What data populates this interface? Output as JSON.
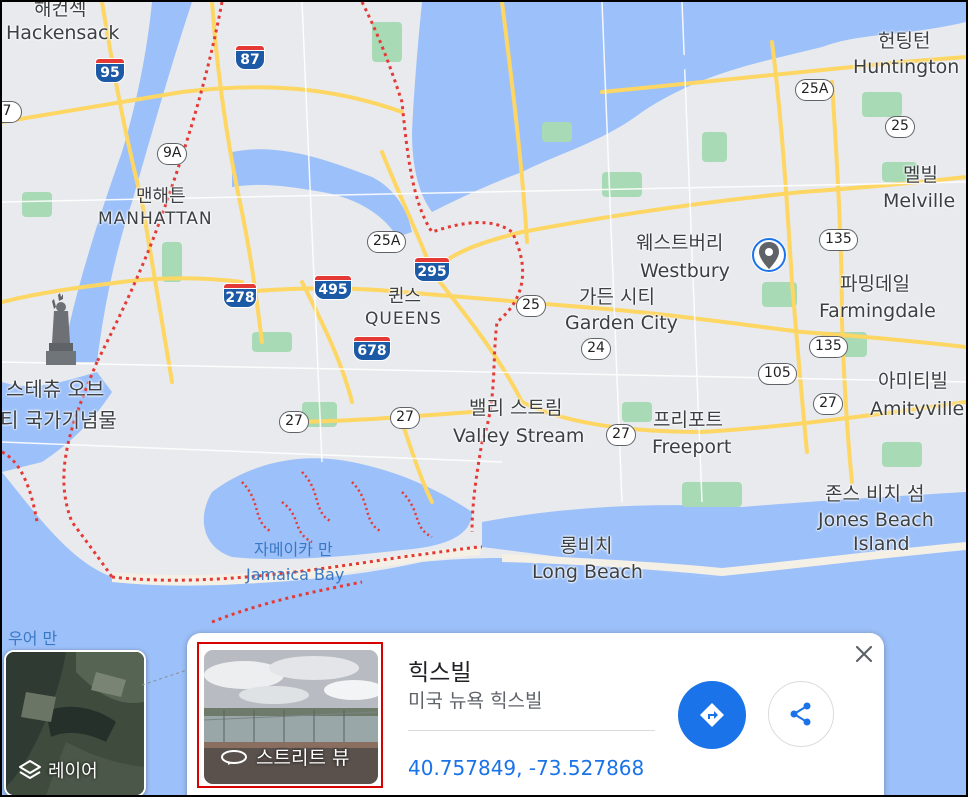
{
  "map": {
    "colors": {
      "water": "#9cc0f9",
      "land": "#e8eaed",
      "park": "#a8dab5",
      "highway": "#fdd663",
      "boundary": "#e53935"
    },
    "labels": {
      "hackensack_ko": "해컨섹",
      "hackensack": "Hackensack",
      "huntington_ko": "헌팅턴",
      "huntington": "Huntington",
      "melville_ko": "멜빌",
      "melville": "Melville",
      "manhattan_ko": "맨해튼",
      "manhattan": "MANHATTAN",
      "queens_ko": "퀸스",
      "queens": "QUEENS",
      "westbury_ko": "웨스트버리",
      "westbury": "Westbury",
      "gardencity_ko": "가든 시티",
      "gardencity": "Garden City",
      "farmingdale_ko": "파밍데일",
      "farmingdale": "Farmingdale",
      "liberty_ko_1": "스테츄 오브",
      "liberty_ko_2": "티 국가기념물",
      "valleystream_ko": "밸리 스트림",
      "valleystream": "Valley Stream",
      "freeport_ko": "프리포트",
      "freeport": "Freeport",
      "amityville_ko": "아미티빌",
      "amityville": "Amityville",
      "jonesbeach_ko": "존스 비치 섬",
      "jonesbeach_1": "Jones Beach",
      "jonesbeach_2": "Island",
      "longbeach_ko": "롱비치",
      "longbeach": "Long Beach",
      "jamaicabay_ko": "자메이카 만",
      "jamaicabay": "Jamaica Bay",
      "bay_partial": "우어 만"
    },
    "shields": {
      "i95": "95",
      "i87": "87",
      "i278": "278",
      "i495": "495",
      "i295": "295",
      "i678": "678",
      "r9a": "9A",
      "r25a": "25A",
      "r25a_e": "25A",
      "r25_e": "25",
      "r25": "25",
      "r24": "24",
      "r135_n": "135",
      "r135_s": "135",
      "r105": "105",
      "r27_e": "27",
      "r27_m": "27",
      "r27_w": "27",
      "r27_f": "27",
      "r7": "7"
    }
  },
  "layer": {
    "label": "레이어",
    "icon": "layers-icon"
  },
  "card": {
    "title": "힉스빌",
    "subtitle": "미국 뉴욕 힉스빌",
    "coordinates": "40.757849, -73.527868",
    "streetview_label": "스트리트 뷰",
    "directions_icon": "directions-icon",
    "share_icon": "share-icon",
    "close_icon": "close-icon"
  }
}
